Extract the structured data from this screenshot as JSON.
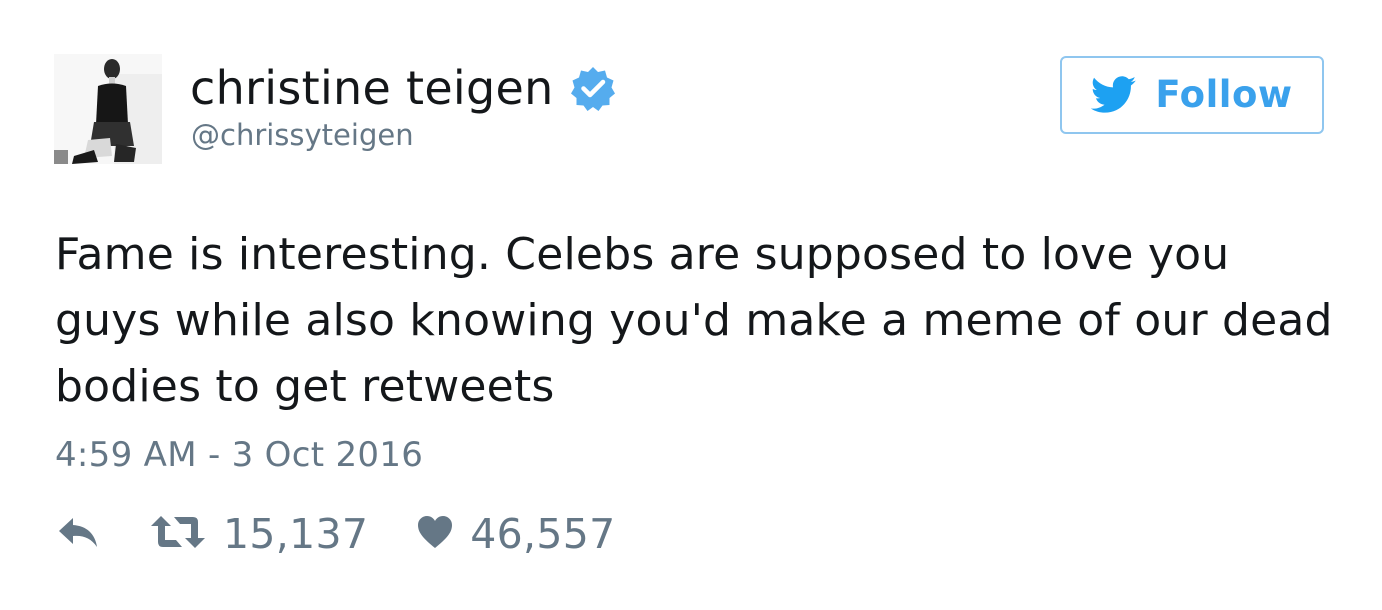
{
  "user": {
    "display_name": "christine teigen",
    "handle": "@chrissyteigen",
    "verified_icon": "verified-badge-icon",
    "avatar_icon": "profile-photo"
  },
  "follow_button": {
    "label": "Follow",
    "icon": "twitter-bird-icon"
  },
  "tweet": {
    "text": "Fame is interesting. Celebs are supposed to love you guys while also knowing you'd make a meme of our dead bodies to get retweets",
    "timestamp": "4:59 AM - 3 Oct 2016"
  },
  "actions": {
    "reply_icon": "reply-icon",
    "retweet_icon": "retweet-icon",
    "retweet_count": "15,137",
    "like_icon": "heart-icon",
    "like_count": "46,557"
  },
  "colors": {
    "text": "#14171a",
    "muted": "#657786",
    "brand_blue": "#1da1f2",
    "follow_text": "#3aa1ec",
    "follow_border": "#8fc6ef",
    "verified": "#55acee"
  }
}
